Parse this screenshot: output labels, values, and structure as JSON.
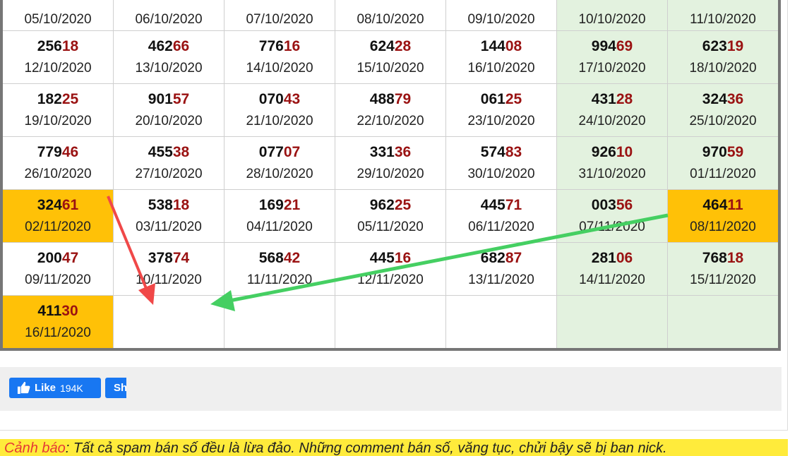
{
  "calendar": {
    "rows": [
      [
        {
          "head": "",
          "tail": "",
          "date": "05/10/2020"
        },
        {
          "head": "",
          "tail": "",
          "date": "06/10/2020"
        },
        {
          "head": "",
          "tail": "",
          "date": "07/10/2020"
        },
        {
          "head": "",
          "tail": "",
          "date": "08/10/2020"
        },
        {
          "head": "",
          "tail": "",
          "date": "09/10/2020"
        },
        {
          "head": "",
          "tail": "",
          "date": "10/10/2020"
        },
        {
          "head": "",
          "tail": "",
          "date": "11/10/2020"
        }
      ],
      [
        {
          "head": "256",
          "tail": "18",
          "date": "12/10/2020"
        },
        {
          "head": "462",
          "tail": "66",
          "date": "13/10/2020"
        },
        {
          "head": "776",
          "tail": "16",
          "date": "14/10/2020"
        },
        {
          "head": "624",
          "tail": "28",
          "date": "15/10/2020"
        },
        {
          "head": "144",
          "tail": "08",
          "date": "16/10/2020"
        },
        {
          "head": "994",
          "tail": "69",
          "date": "17/10/2020"
        },
        {
          "head": "623",
          "tail": "19",
          "date": "18/10/2020"
        }
      ],
      [
        {
          "head": "182",
          "tail": "25",
          "date": "19/10/2020"
        },
        {
          "head": "901",
          "tail": "57",
          "date": "20/10/2020"
        },
        {
          "head": "070",
          "tail": "43",
          "date": "21/10/2020"
        },
        {
          "head": "488",
          "tail": "79",
          "date": "22/10/2020"
        },
        {
          "head": "061",
          "tail": "25",
          "date": "23/10/2020"
        },
        {
          "head": "431",
          "tail": "28",
          "date": "24/10/2020"
        },
        {
          "head": "324",
          "tail": "36",
          "date": "25/10/2020"
        }
      ],
      [
        {
          "head": "779",
          "tail": "46",
          "date": "26/10/2020"
        },
        {
          "head": "455",
          "tail": "38",
          "date": "27/10/2020"
        },
        {
          "head": "077",
          "tail": "07",
          "date": "28/10/2020"
        },
        {
          "head": "331",
          "tail": "36",
          "date": "29/10/2020"
        },
        {
          "head": "574",
          "tail": "83",
          "date": "30/10/2020"
        },
        {
          "head": "926",
          "tail": "10",
          "date": "31/10/2020"
        },
        {
          "head": "970",
          "tail": "59",
          "date": "01/11/2020"
        }
      ],
      [
        {
          "head": "324",
          "tail": "61",
          "date": "02/11/2020"
        },
        {
          "head": "538",
          "tail": "18",
          "date": "03/11/2020"
        },
        {
          "head": "169",
          "tail": "21",
          "date": "04/11/2020"
        },
        {
          "head": "962",
          "tail": "25",
          "date": "05/11/2020"
        },
        {
          "head": "445",
          "tail": "71",
          "date": "06/11/2020"
        },
        {
          "head": "003",
          "tail": "56",
          "date": "07/11/2020"
        },
        {
          "head": "464",
          "tail": "11",
          "date": "08/11/2020"
        }
      ],
      [
        {
          "head": "200",
          "tail": "47",
          "date": "09/11/2020"
        },
        {
          "head": "378",
          "tail": "74",
          "date": "10/11/2020"
        },
        {
          "head": "568",
          "tail": "42",
          "date": "11/11/2020"
        },
        {
          "head": "445",
          "tail": "16",
          "date": "12/11/2020"
        },
        {
          "head": "682",
          "tail": "87",
          "date": "13/11/2020"
        },
        {
          "head": "281",
          "tail": "06",
          "date": "14/11/2020"
        },
        {
          "head": "768",
          "tail": "18",
          "date": "15/11/2020"
        }
      ],
      [
        {
          "head": "411",
          "tail": "30",
          "date": "16/11/2020"
        },
        {
          "head": "",
          "tail": "",
          "date": ""
        },
        {
          "head": "",
          "tail": "",
          "date": ""
        },
        {
          "head": "",
          "tail": "",
          "date": ""
        },
        {
          "head": "",
          "tail": "",
          "date": ""
        },
        {
          "head": "",
          "tail": "",
          "date": ""
        },
        {
          "head": "",
          "tail": "",
          "date": ""
        }
      ]
    ],
    "highlight_color": "#ffc107",
    "weekend_color": "#e3f2df",
    "tail_color": "#9a1212"
  },
  "social": {
    "like_label": "Like",
    "like_count": "194K",
    "share_label": "Sh",
    "icon": "thumbs-up-icon"
  },
  "warning": {
    "label": "Cảnh báo",
    "text": ": Tất cả spam bán số đều là lừa đảo. Những comment bán số, văng tục, chửi bậy sẽ bị ban nick."
  },
  "annotations": {
    "red_arrow_color": "#f04848",
    "green_arrow_color": "#45cf62"
  }
}
